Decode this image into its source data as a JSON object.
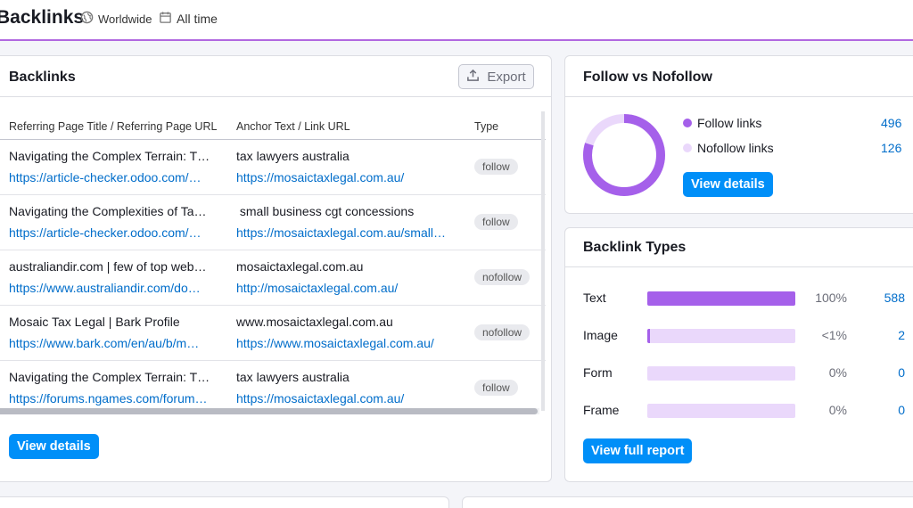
{
  "header": {
    "title": "Backlinks",
    "region": "Worldwide",
    "period": "All time"
  },
  "backlinks": {
    "title": "Backlinks",
    "export_label": "Export",
    "columns": [
      "Referring Page Title / Referring Page URL",
      "Anchor Text / Link URL",
      "Type"
    ],
    "rows": [
      {
        "title": "Navigating the Complex Terrain: T…",
        "url": "https://article-checker.odoo.com/…",
        "anchor": "tax lawyers australia",
        "link": "https://mosaictaxlegal.com.au/",
        "type": "follow"
      },
      {
        "title": "Navigating the Complexities of Ta…",
        "url": "https://article-checker.odoo.com/…",
        "anchor": " small business cgt concessions",
        "link": "https://mosaictaxlegal.com.au/small…",
        "type": "follow"
      },
      {
        "title": "australiandir.com | few of top web…",
        "url": "https://www.australiandir.com/do…",
        "anchor": "mosaictaxlegal.com.au",
        "link": "http://mosaictaxlegal.com.au/",
        "type": "nofollow"
      },
      {
        "title": "Mosaic Tax Legal | Bark Profile",
        "url": "https://www.bark.com/en/au/b/m…",
        "anchor": "www.mosaictaxlegal.com.au",
        "link": "https://www.mosaictaxlegal.com.au/",
        "type": "nofollow"
      },
      {
        "title": "Navigating the Complex Terrain: T…",
        "url": "https://forums.ngames.com/forum…",
        "anchor": "tax lawyers australia",
        "link": "https://mosaictaxlegal.com.au/",
        "type": "follow"
      }
    ],
    "view_details": "View details"
  },
  "follow": {
    "title": "Follow vs Nofollow",
    "items": [
      {
        "label": "Follow links",
        "value": "496",
        "color": "#a560ea"
      },
      {
        "label": "Nofollow links",
        "value": "126",
        "color": "#ead8fb"
      }
    ],
    "view_details": "View details"
  },
  "types": {
    "title": "Backlink Types",
    "rows": [
      {
        "label": "Text",
        "pct": "100%",
        "count": "588",
        "fill": 1.0
      },
      {
        "label": "Image",
        "pct": "<1%",
        "count": "2",
        "fill": 0.01
      },
      {
        "label": "Form",
        "pct": "0%",
        "count": "0",
        "fill": 0
      },
      {
        "label": "Frame",
        "pct": "0%",
        "count": "0",
        "fill": 0
      }
    ],
    "view_report": "View full report"
  },
  "colors": {
    "accent": "#a560ea",
    "accent_light": "#ead8fb",
    "button": "#008ff8",
    "link": "#006dca"
  }
}
